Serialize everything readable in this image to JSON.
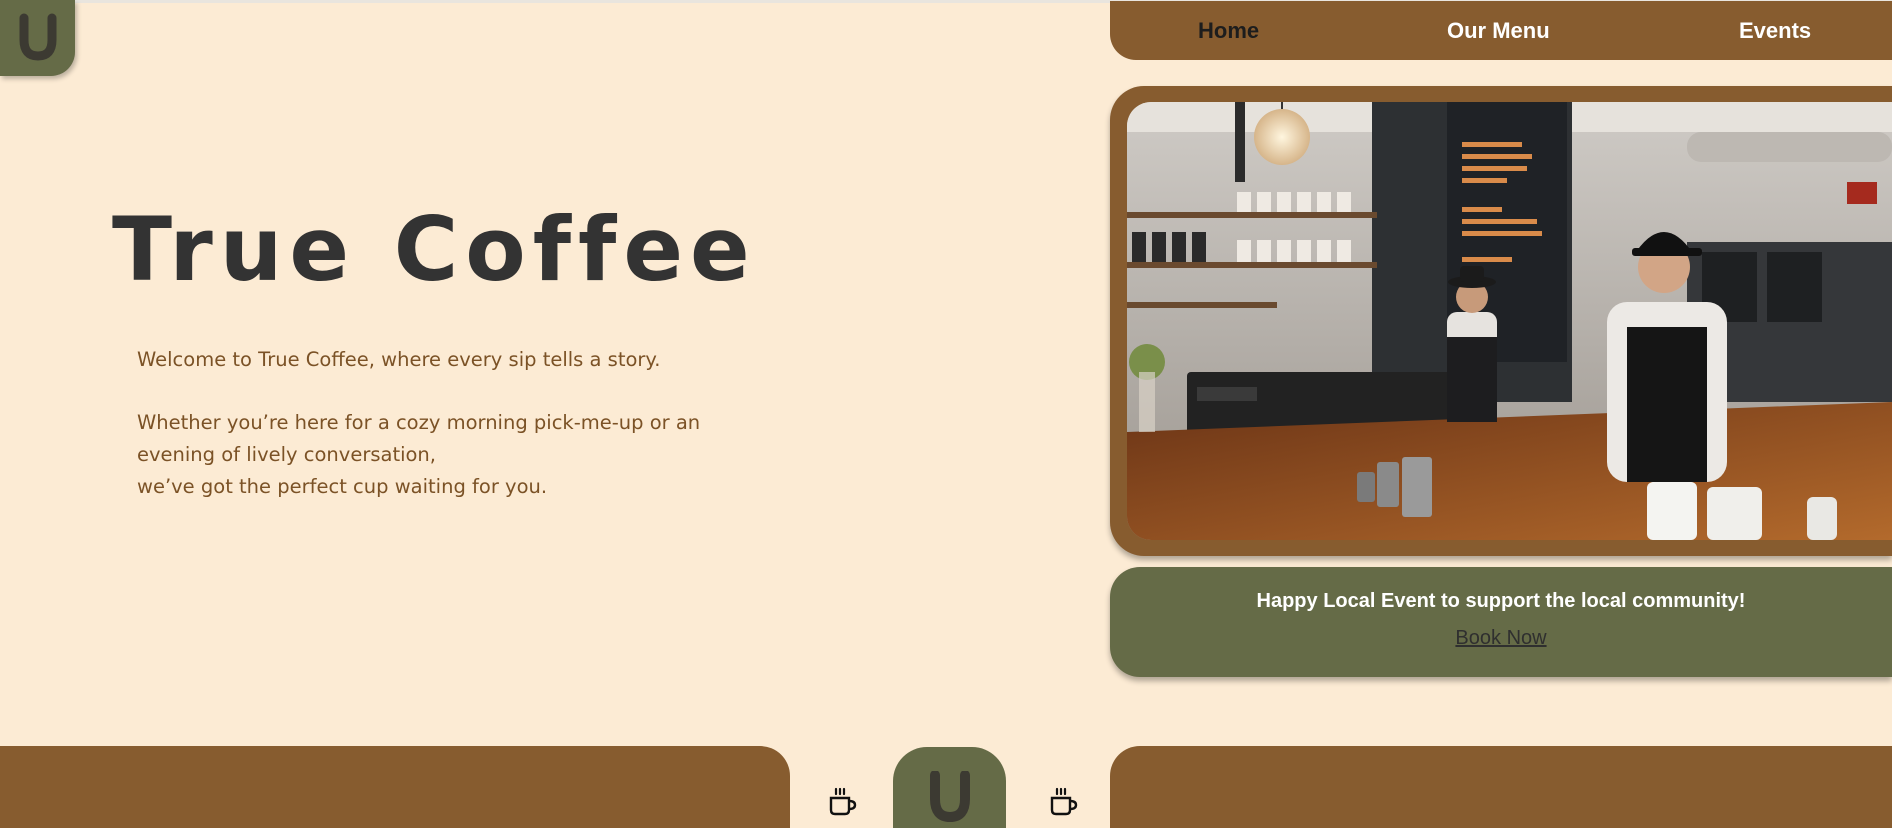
{
  "brand": {
    "logo_icon": "u-logo-icon",
    "colors": {
      "background": "#fcebd4",
      "brown": "#875c2f",
      "olive": "#656b47",
      "title": "#333333",
      "body_text": "#7b5226"
    }
  },
  "nav": {
    "items": [
      {
        "label": "Home",
        "active": true
      },
      {
        "label": "Our Menu",
        "active": false
      },
      {
        "label": "Events",
        "active": false
      }
    ]
  },
  "hero": {
    "title": "True Coffee",
    "welcome": "Welcome to True Coffee, where every sip tells a story.",
    "line1": "Whether you’re here for a cozy morning pick-me-up or an",
    "line2": "evening of lively conversation,",
    "line3": "we’ve got the perfect cup waiting for you."
  },
  "photo": {
    "icon": "coffee-shop-photo"
  },
  "event": {
    "text": "Happy Local Event to support the local community!",
    "link_label": "Book Now"
  },
  "footer": {
    "icons": [
      "coffee-cup-icon",
      "u-logo-icon",
      "coffee-cup-icon"
    ]
  }
}
